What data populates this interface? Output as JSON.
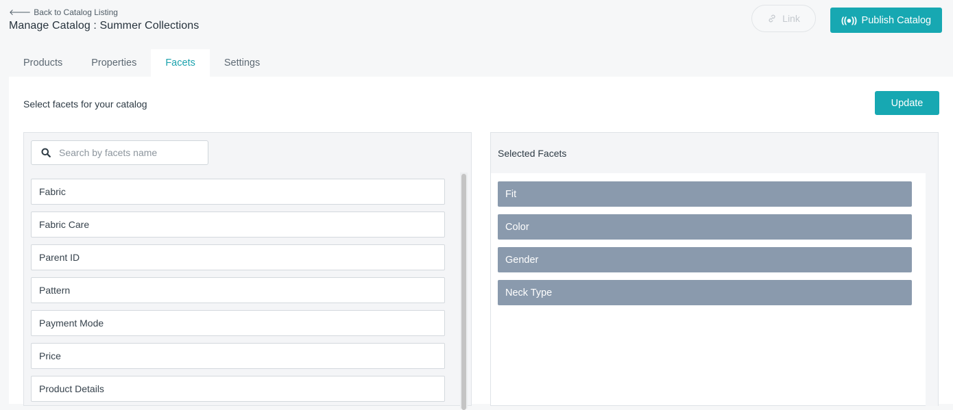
{
  "header": {
    "back_label": "Back to Catalog Listing",
    "title": "Manage Catalog : Summer Collections",
    "link_label": "Link",
    "publish_label": "Publish Catalog"
  },
  "tabs": [
    {
      "label": "Products"
    },
    {
      "label": "Properties"
    },
    {
      "label": "Facets"
    },
    {
      "label": "Settings"
    }
  ],
  "active_tab": "Facets",
  "content": {
    "heading": "Select facets for your catalog",
    "update_label": "Update",
    "search": {
      "placeholder": "Search by facets name",
      "value": ""
    },
    "available_facets": [
      {
        "label": "Fabric"
      },
      {
        "label": "Fabric Care"
      },
      {
        "label": "Parent ID"
      },
      {
        "label": "Pattern"
      },
      {
        "label": "Payment Mode"
      },
      {
        "label": "Price"
      },
      {
        "label": "Product Details"
      }
    ],
    "selected_title": "Selected Facets",
    "selected_facets": [
      {
        "label": "Fit"
      },
      {
        "label": "Color"
      },
      {
        "label": "Gender"
      },
      {
        "label": "Neck Type"
      }
    ]
  },
  "icons": {
    "back": "arrow-left-icon",
    "link": "link-icon",
    "publish": "broadcast-icon",
    "search": "search-icon"
  },
  "colors": {
    "accent": "#17a8b2",
    "selected_item": "#8a9aad",
    "active_tab_text": "#1ba2ad"
  }
}
